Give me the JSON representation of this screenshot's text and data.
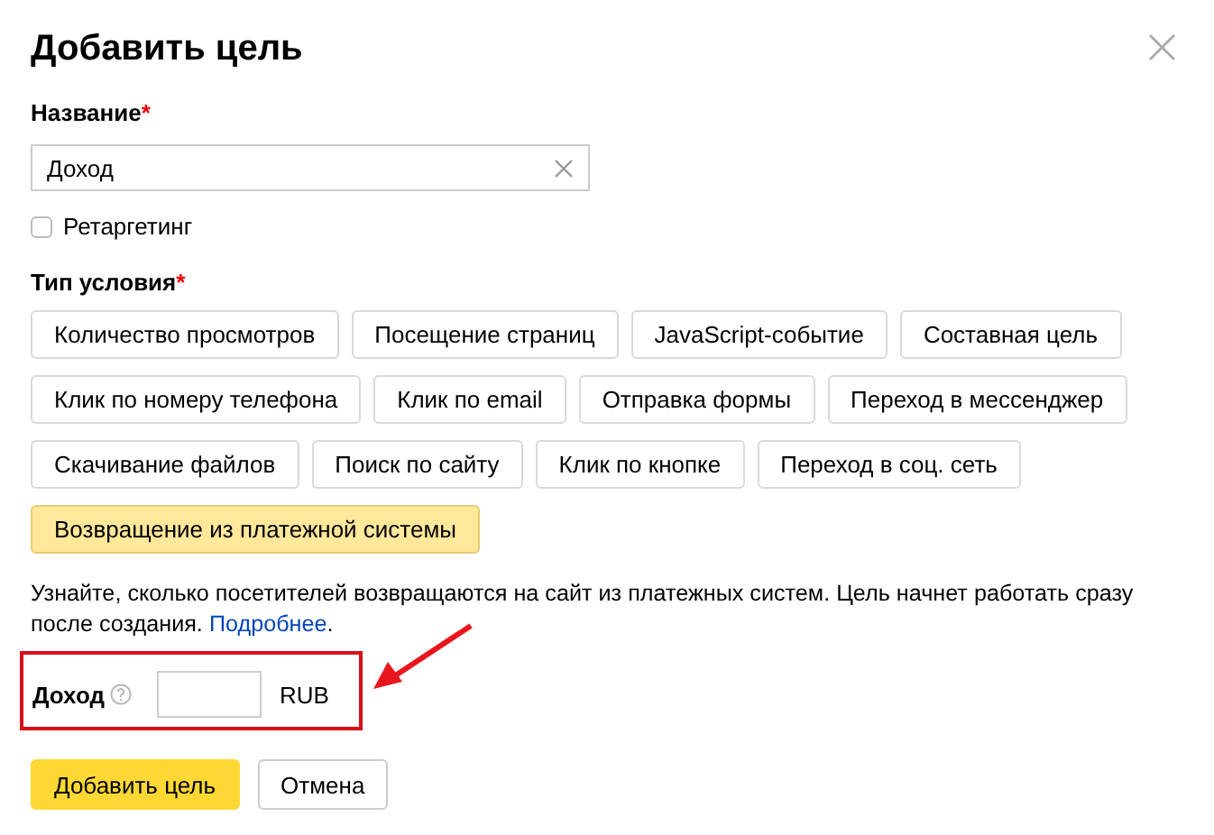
{
  "dialog": {
    "title": "Добавить цель",
    "close": "×"
  },
  "name_field": {
    "label": "Название",
    "required_mark": "*",
    "value": "Доход"
  },
  "retargeting": {
    "label": "Ретаргетинг",
    "checked": false
  },
  "condition": {
    "label": "Тип условия",
    "required_mark": "*",
    "options": [
      [
        {
          "label": "Количество просмотров",
          "selected": false
        },
        {
          "label": "Посещение страниц",
          "selected": false
        },
        {
          "label": "JavaScript-событие",
          "selected": false
        },
        {
          "label": "Составная цель",
          "selected": false
        }
      ],
      [
        {
          "label": "Клик по номеру телефона",
          "selected": false
        },
        {
          "label": "Клик по email",
          "selected": false
        },
        {
          "label": "Отправка формы",
          "selected": false
        },
        {
          "label": "Переход в мессенджер",
          "selected": false
        }
      ],
      [
        {
          "label": "Скачивание файлов",
          "selected": false
        },
        {
          "label": "Поиск по сайту",
          "selected": false
        },
        {
          "label": "Клик по кнопке",
          "selected": false
        },
        {
          "label": "Переход в соц. сеть",
          "selected": false
        }
      ],
      [
        {
          "label": "Возвращение из платежной системы",
          "selected": true
        }
      ]
    ]
  },
  "description": {
    "text": "Узнайте, сколько посетителей возвращаются на сайт из платежных систем. Цель начнет работать сразу после создания. ",
    "link": "Подробнее",
    "tail": "."
  },
  "income": {
    "label": "Доход",
    "currency": "RUB",
    "highlighted": true
  },
  "buttons": [
    {
      "label": "Добавить цель",
      "kind": "primary"
    },
    {
      "label": "Отмена",
      "kind": "secondary"
    }
  ]
}
